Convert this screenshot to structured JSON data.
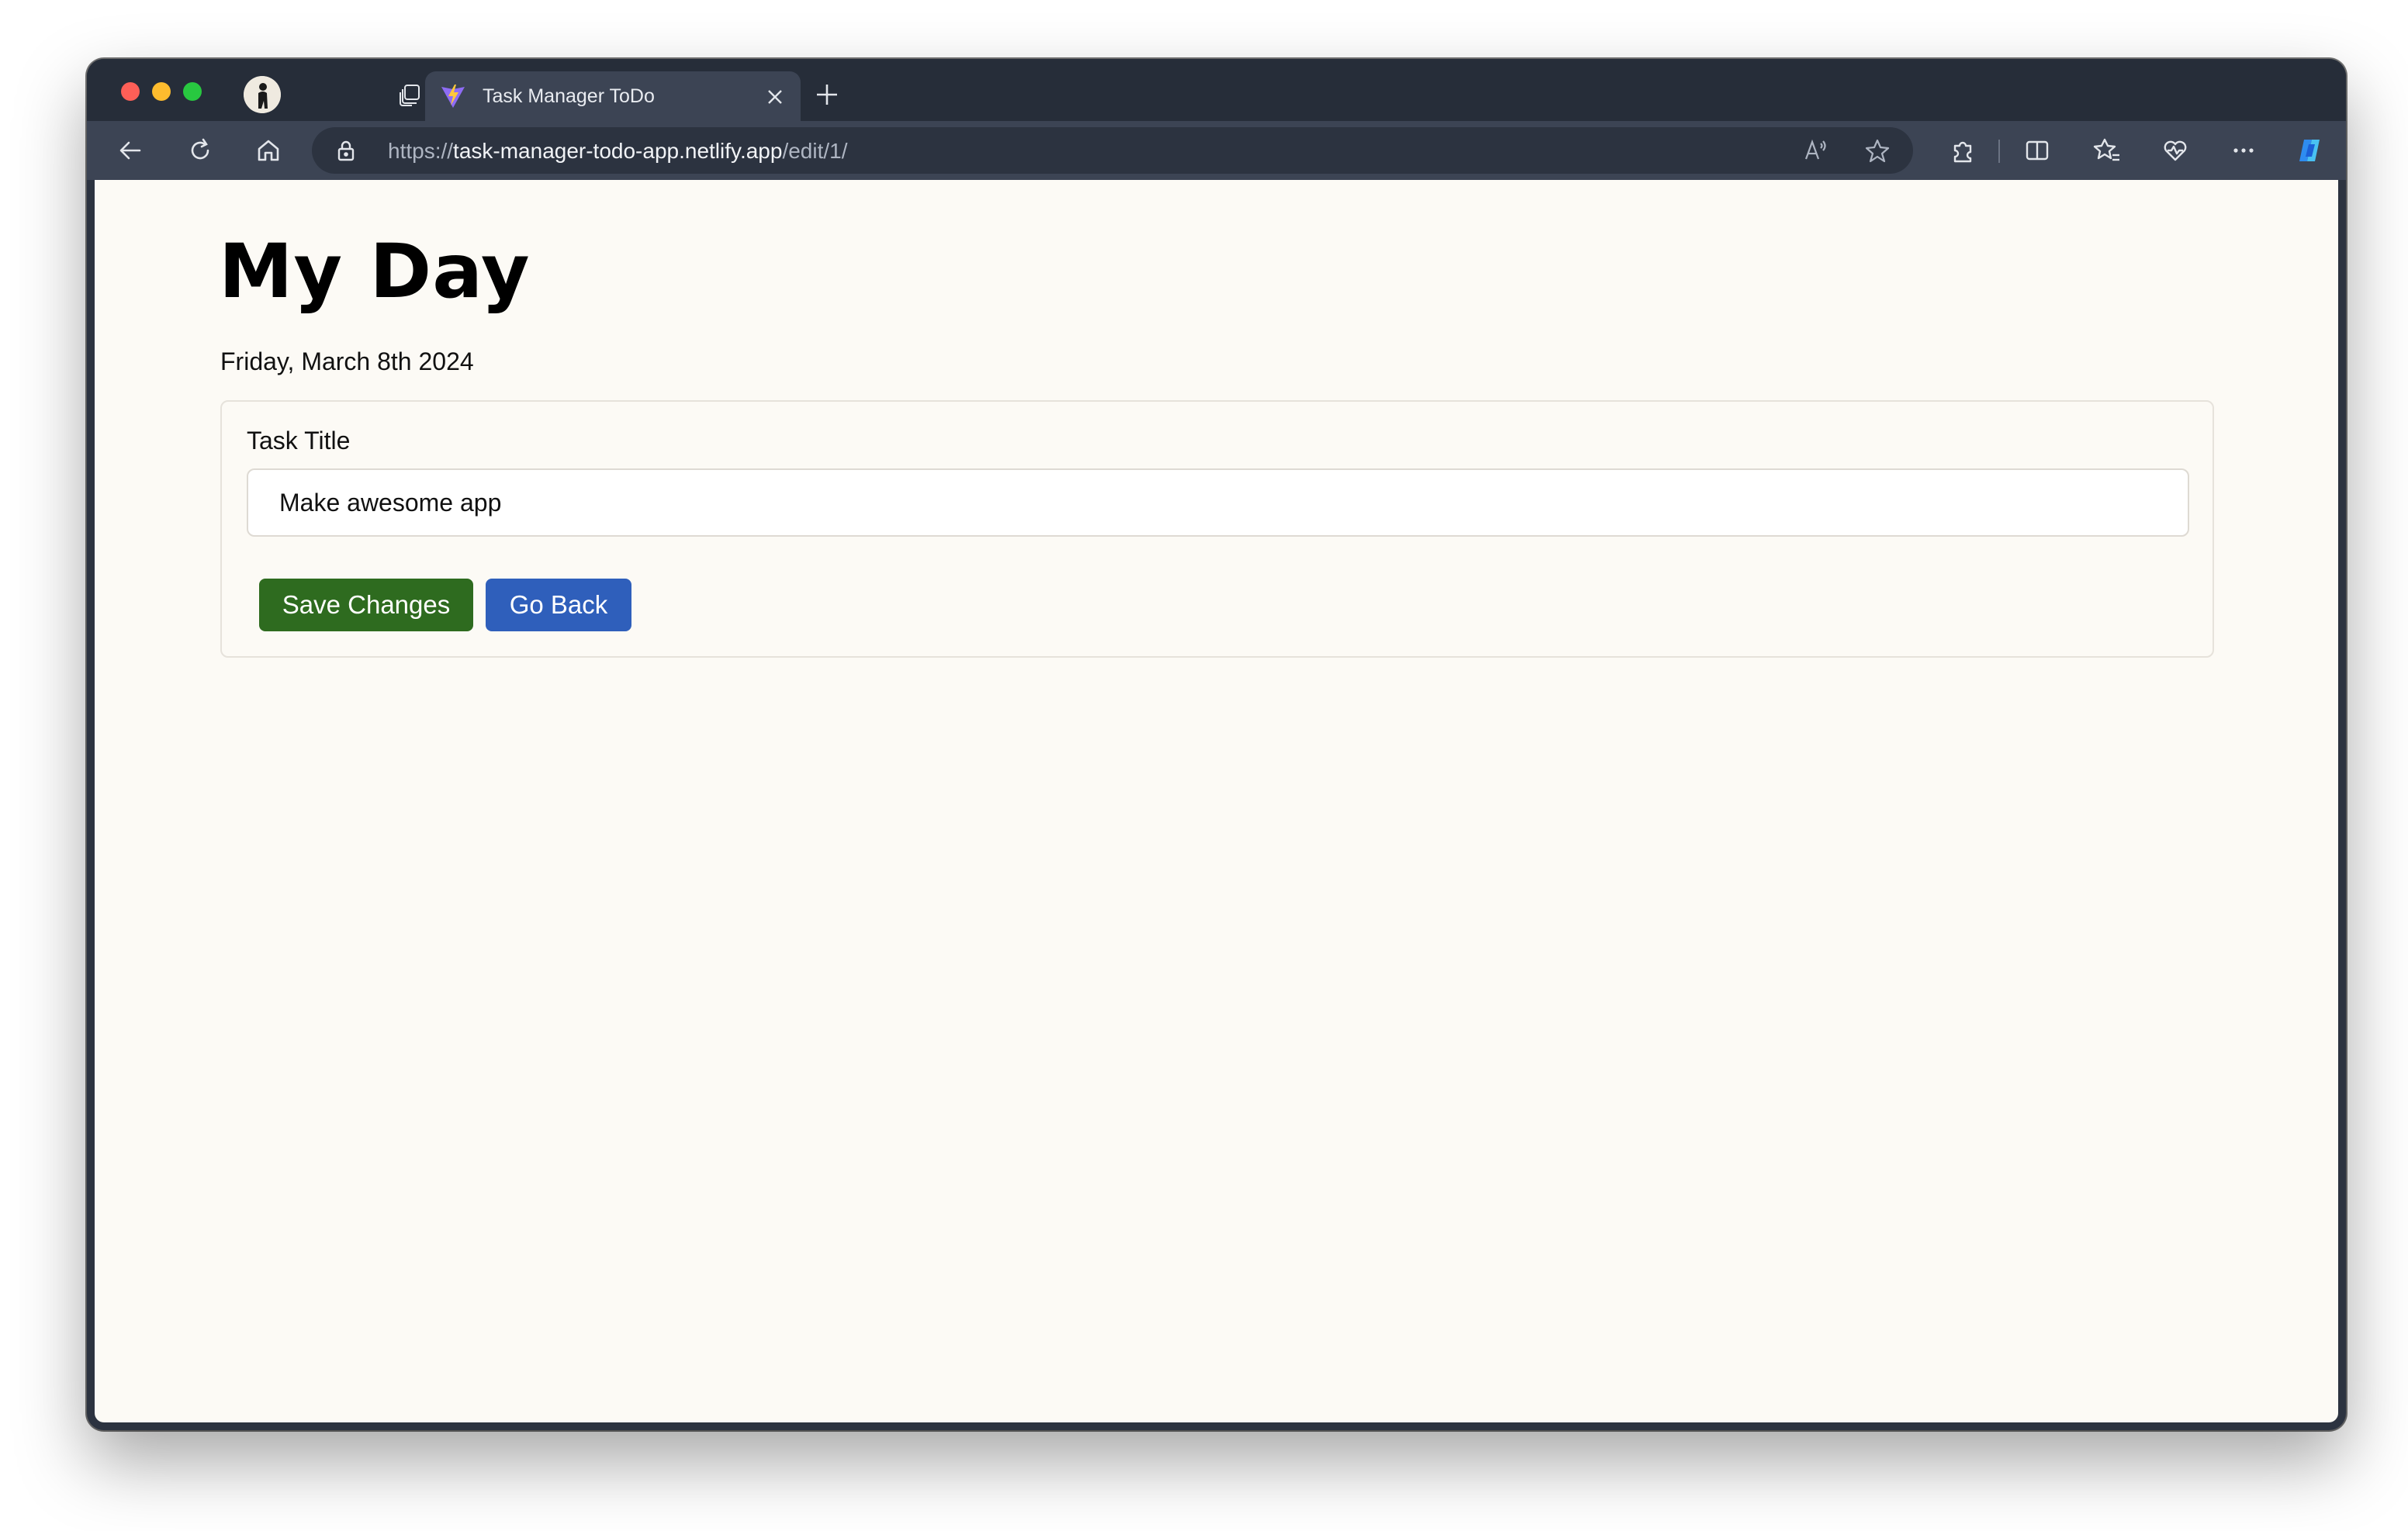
{
  "browser": {
    "tab": {
      "title": "Task Manager ToDo"
    },
    "address_bar": {
      "scheme": "https://",
      "host": "task-manager-todo-app.netlify.app",
      "path": "/edit/1/"
    },
    "icons": {
      "profile": "profile-avatar",
      "workspaces": "workspaces-icon",
      "vertical_tabs": "tab-actions-icon",
      "back": "back-arrow-icon",
      "refresh": "refresh-icon",
      "home": "home-icon",
      "lock": "lock-icon",
      "read_aloud": "read-aloud-icon",
      "favorite": "star-icon",
      "extensions": "puzzle-icon",
      "split_screen": "split-screen-icon",
      "favorites": "favorites-icon",
      "browser_essentials": "heart-pulse-icon",
      "more": "more-icon",
      "copilot": "copilot-icon"
    }
  },
  "page": {
    "title": "My Day",
    "date": "Friday, March 8th 2024",
    "form": {
      "label": "Task Title",
      "value": "Make awesome app",
      "save_label": "Save Changes",
      "back_label": "Go Back"
    }
  },
  "colors": {
    "save_button": "#2e6b1f",
    "back_button": "#2f5fbb",
    "page_background": "#fcfaf5"
  }
}
